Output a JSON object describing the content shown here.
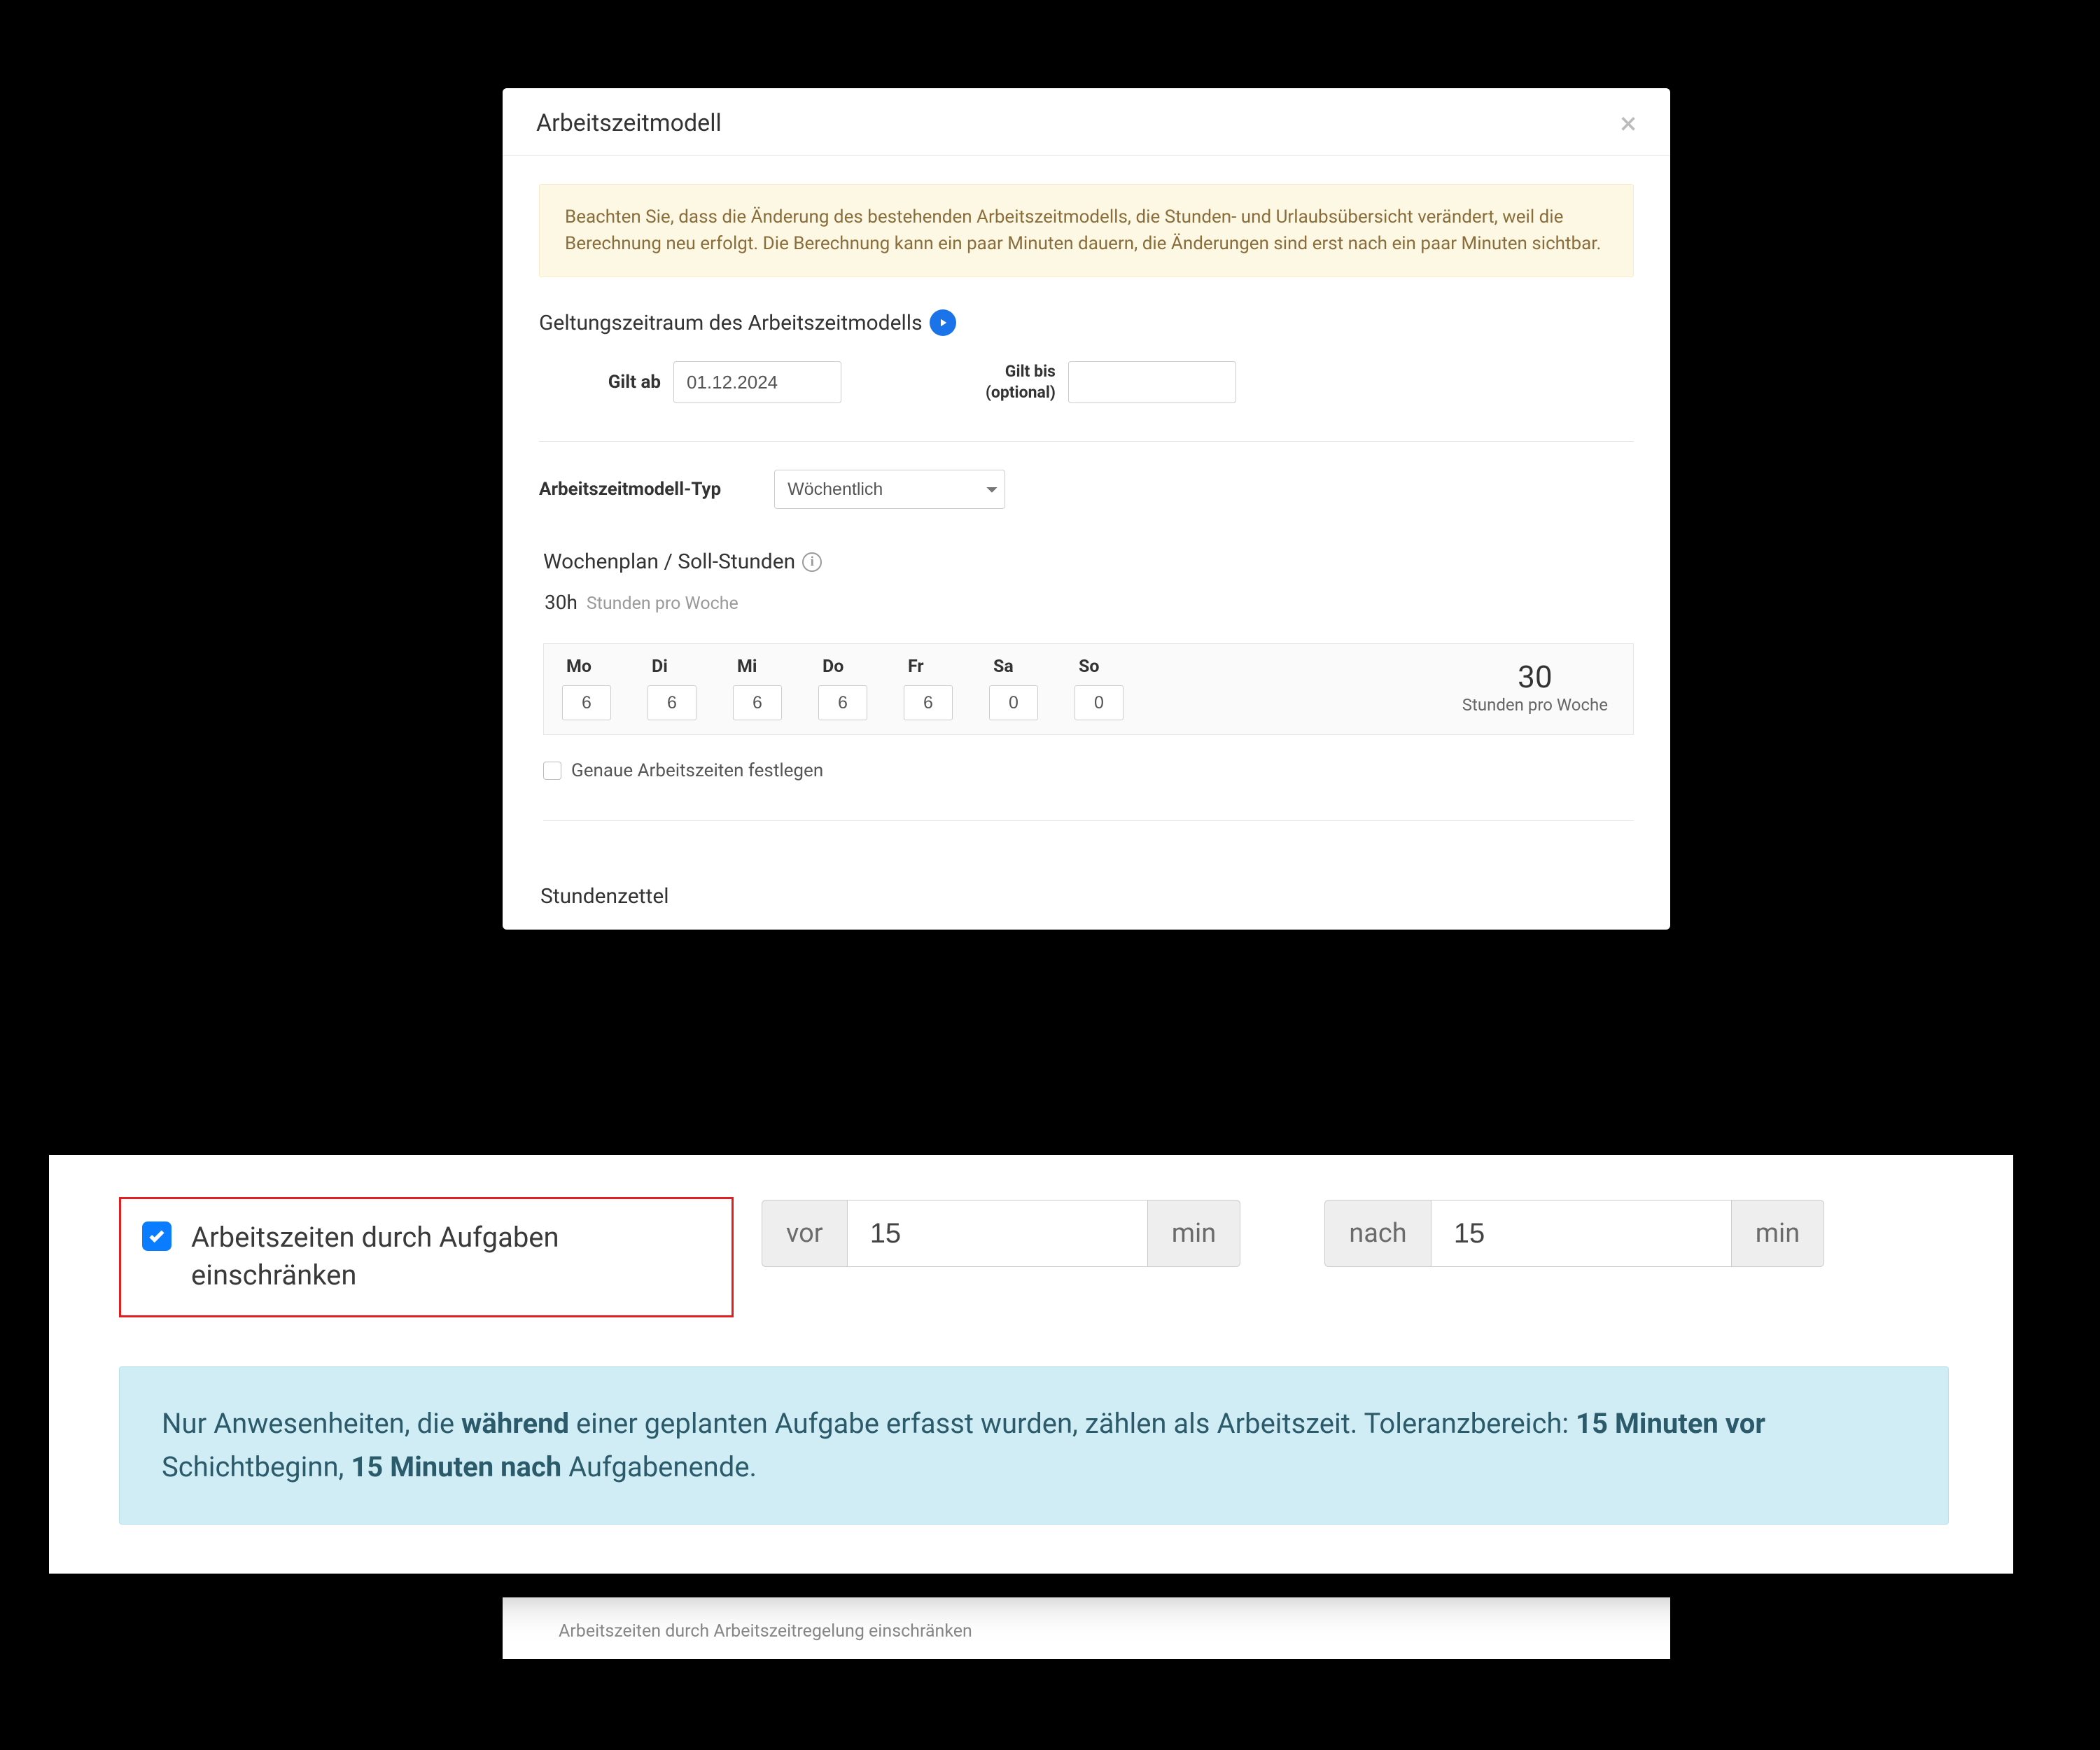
{
  "modal": {
    "title": "Arbeitszeitmodell",
    "close_glyph": "×",
    "warning": "Beachten Sie, dass die Änderung des bestehenden Arbeitszeitmodells, die Stunden- und Urlaubsübersicht verändert, weil die Berechnung neu erfolgt. Die Berechnung kann ein paar Minuten dauern, die Änderungen sind erst nach ein paar Minuten sichtbar.",
    "validity": {
      "heading": "Geltungszeitraum des Arbeitszeitmodells",
      "from_label": "Gilt ab",
      "from_value": "01.12.2024",
      "to_label_line1": "Gilt bis",
      "to_label_line2": "(optional)",
      "to_value": ""
    },
    "type": {
      "label": "Arbeitszeitmodell-Typ",
      "selected": "Wöchentlich"
    },
    "weekplan": {
      "heading": "Wochenplan / Soll-Stunden",
      "hours_value": "30h",
      "hours_label": "Stunden pro Woche",
      "total_value": "30",
      "total_label": "Stunden pro Woche",
      "days": [
        {
          "key": "Mo",
          "value": "6"
        },
        {
          "key": "Di",
          "value": "6"
        },
        {
          "key": "Mi",
          "value": "6"
        },
        {
          "key": "Do",
          "value": "6"
        },
        {
          "key": "Fr",
          "value": "6"
        },
        {
          "key": "Sa",
          "value": "0"
        },
        {
          "key": "So",
          "value": "0"
        }
      ],
      "exact_times_label": "Genaue Arbeitszeiten festlegen"
    },
    "timesheet_heading": "Stundenzettel",
    "tail_text": "Arbeitszeiten durch Arbeitszeitregelung einschränken"
  },
  "overlay": {
    "restrict_label": "Arbeitszeiten durch Aufgaben einschränken",
    "before": {
      "prefix": "vor",
      "value": "15",
      "suffix": "min"
    },
    "after": {
      "prefix": "nach",
      "value": "15",
      "suffix": "min"
    },
    "info_pre": "Nur Anwesenheiten, die ",
    "info_bold1": "während",
    "info_mid1": " einer geplanten Aufgabe erfasst wurden, zählen als Arbeitszeit. Toleranzbereich: ",
    "info_bold2": "15 Minuten vor",
    "info_mid2": " Schichtbeginn, ",
    "info_bold3": "15 Minuten nach",
    "info_tail": " Aufgabenende."
  }
}
